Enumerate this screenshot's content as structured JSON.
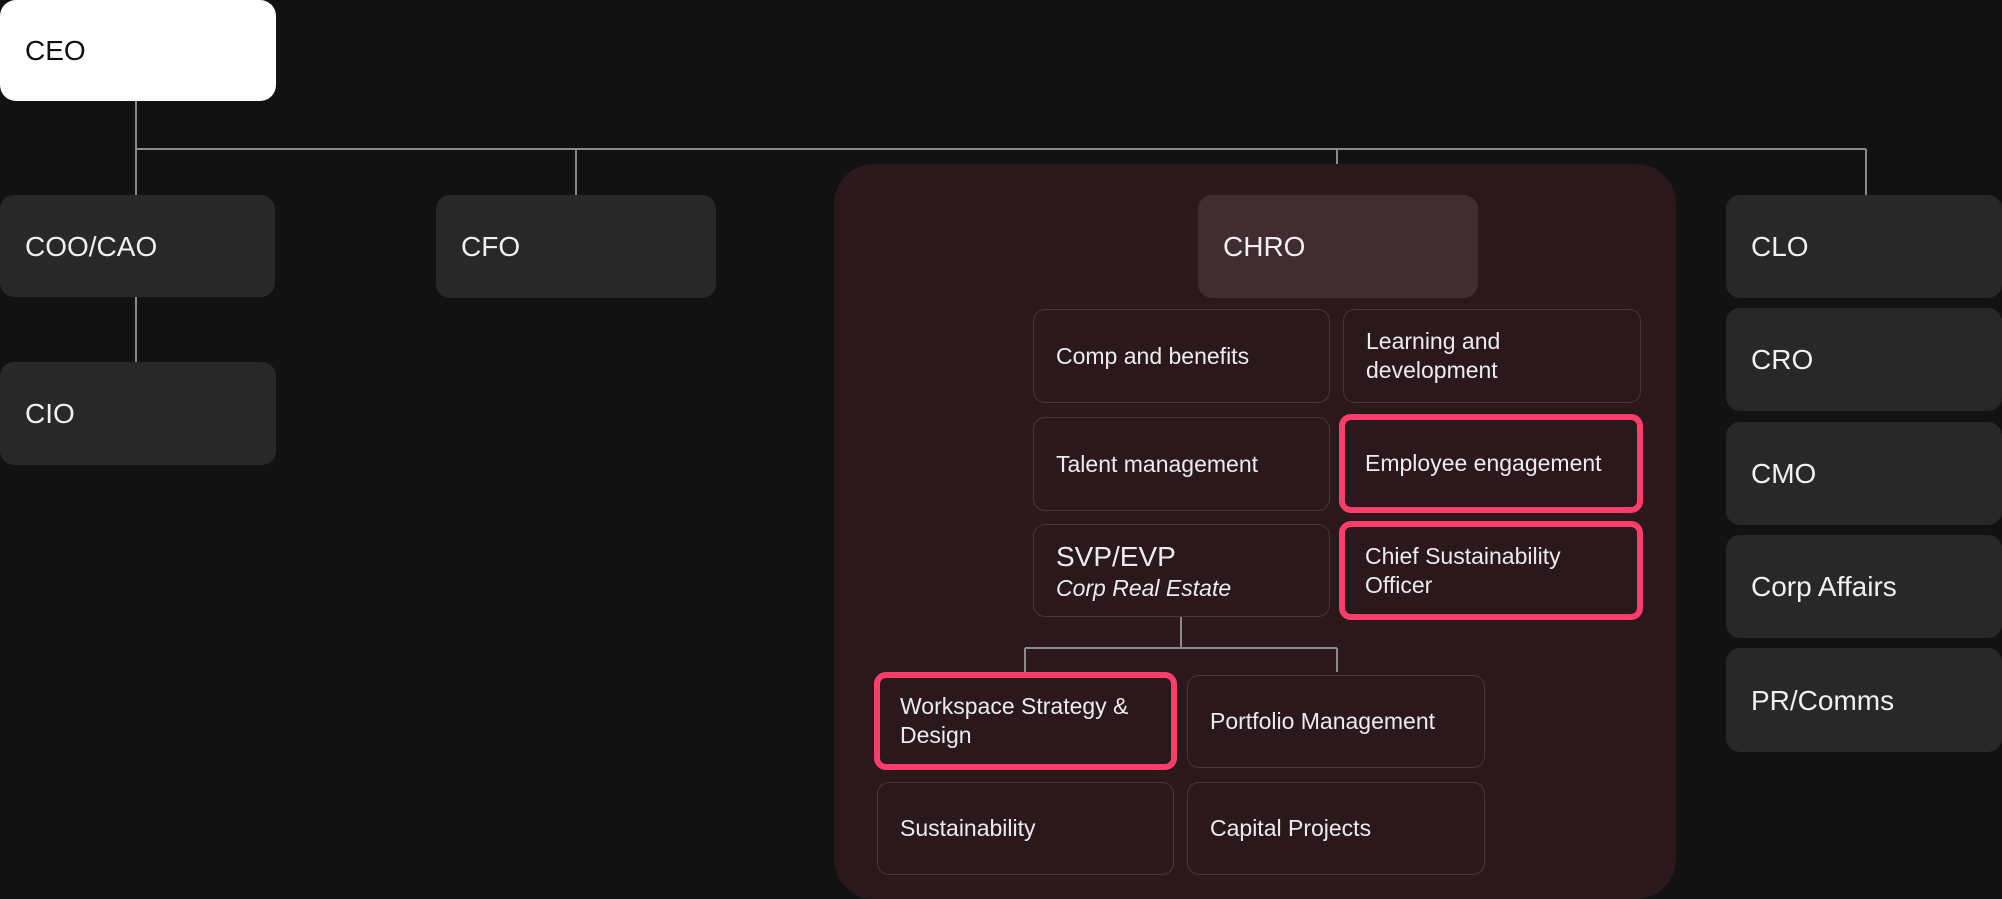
{
  "ceo": "CEO",
  "left_execs": {
    "coo": "COO/CAO",
    "cio": "CIO",
    "cfo": "CFO"
  },
  "chro": {
    "title": "CHRO",
    "functions": {
      "comp_benefits": "Comp and benefits",
      "learning": "Learning and development",
      "talent": "Talent management",
      "engagement": "Employee engagement",
      "svp_title": "SVP/EVP",
      "svp_sub": "Corp Real Estate",
      "sustainability_officer": "Chief Sustainability Officer"
    },
    "real_estate": {
      "workspace": "Workspace Strategy & Design",
      "portfolio": "Portfolio Management",
      "sustainability": "Sustainability",
      "capital": "Capital Projects"
    }
  },
  "right_execs": [
    "CLO",
    "CRO",
    "CMO",
    "Corp Affairs",
    "PR/Comms"
  ],
  "colors": {
    "background": "#121212",
    "box": "#282828",
    "panel": "#2b181c",
    "highlight": "#ff3d6b",
    "connector": "#8a8a8a"
  }
}
